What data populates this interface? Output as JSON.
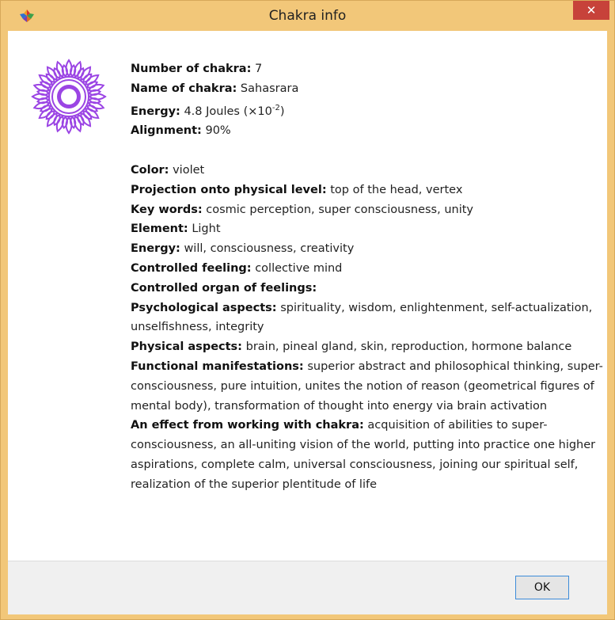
{
  "window": {
    "title": "Chakra info",
    "close_glyph": "✕"
  },
  "icons": {
    "app": "app-icon",
    "chakra": "sahasrara-lotus-icon",
    "accent": "#9b45e4"
  },
  "info": {
    "number_label": "Number of chakra:",
    "number_value": "7",
    "name_label": "Name of chakra:",
    "name_value": "Sahasrara",
    "energy_label": "Energy:",
    "energy_value": "4.8 Joules (×10",
    "energy_exp": "-2",
    "energy_close": ")",
    "alignment_label": "Alignment:",
    "alignment_value": "90%"
  },
  "details": {
    "color_label": "Color:",
    "color_value": "violet",
    "projection_label": "Projection onto physical level:",
    "projection_value": "top of the head, vertex",
    "keywords_label": "Key words:",
    "keywords_value": "cosmic perception, super consciousness, unity",
    "element_label": "Element:",
    "element_value": "Light",
    "energy2_label": "Energy:",
    "energy2_value": "will, consciousness, creativity",
    "feeling_label": "Controlled feeling:",
    "feeling_value": "collective mind",
    "organ_label": "Controlled organ of feelings:",
    "psych_label": "Psychological aspects:",
    "psych_value": "spirituality, wisdom, enlightenment, self-actualization, unselfishness, integrity",
    "physical_label": "Physical aspects:",
    "physical_value": "brain, pineal gland, skin, reproduction, hormone balance",
    "functional_label": "Functional manifestations:",
    "functional_value": "superior abstract and philosophical thinking, super-consciousness, pure intuition, unites the notion of reason (geometrical figures of mental body), transformation of thought into energy via brain activation",
    "effect_label": "An effect from working with chakra:",
    "effect_value": "acquisition of abilities to super-consciousness, an all-uniting vision of the world, putting into practice one higher aspirations, complete calm, universal consciousness, joining our spiritual self, realization of the superior plentitude of life"
  },
  "buttons": {
    "ok": "OK"
  }
}
